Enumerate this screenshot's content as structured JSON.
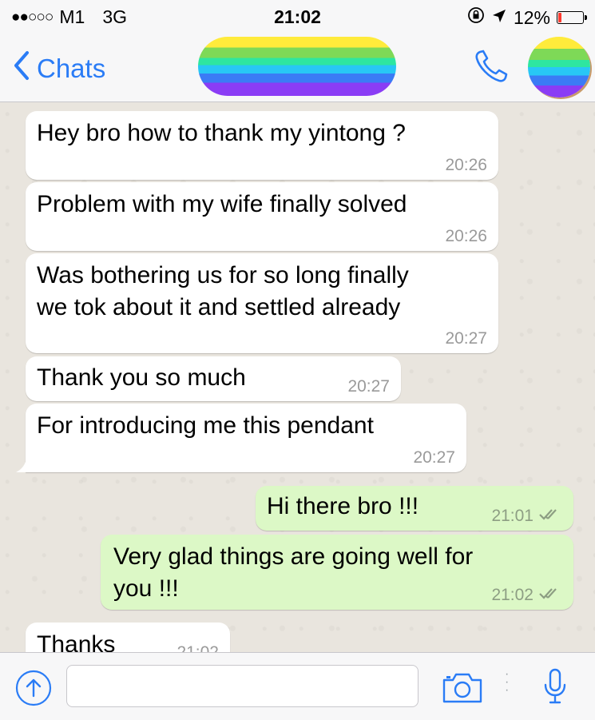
{
  "status_bar": {
    "signal_dots": "●●○○○",
    "carrier": "M1",
    "network": "3G",
    "time": "21:02",
    "battery_percent": "12%",
    "battery_level": 0.12
  },
  "header": {
    "back_label": "Chats"
  },
  "messages": [
    {
      "direction": "in",
      "text_lines": [
        "Hey bro how to thank my yintong ?"
      ],
      "time": "20:26"
    },
    {
      "direction": "in",
      "text_lines": [
        "Problem with my wife finally solved"
      ],
      "time": "20:26"
    },
    {
      "direction": "in",
      "text_lines": [
        "Was bothering us for so long finally",
        "we tok about it and settled already"
      ],
      "time": "20:27"
    },
    {
      "direction": "in",
      "text_lines": [
        "Thank you so much"
      ],
      "time": "20:27"
    },
    {
      "direction": "in",
      "text_lines": [
        "For introducing me this pendant"
      ],
      "time": "20:27"
    },
    {
      "direction": "out",
      "text_lines": [
        "Hi there bro !!!"
      ],
      "time": "21:01",
      "status": "read"
    },
    {
      "direction": "out",
      "text_lines": [
        "Very glad things are going well for",
        "you !!!"
      ],
      "time": "21:02",
      "status": "read"
    },
    {
      "direction": "in",
      "text_lines": [
        "Thanks"
      ],
      "time": "21:02"
    }
  ],
  "input": {
    "placeholder": ""
  },
  "colors": {
    "accent": "#2a7cf6",
    "incoming_bubble": "#ffffff",
    "outgoing_bubble": "#dcf8c6",
    "chat_background": "#e9e5de",
    "read_ticks": "#8d9e83"
  },
  "icons": [
    "lock-rotation-icon",
    "location-arrow-icon",
    "battery-icon",
    "back-chevron-icon",
    "phone-icon",
    "plus-upload-icon",
    "camera-icon",
    "microphone-icon",
    "double-check-icon"
  ]
}
